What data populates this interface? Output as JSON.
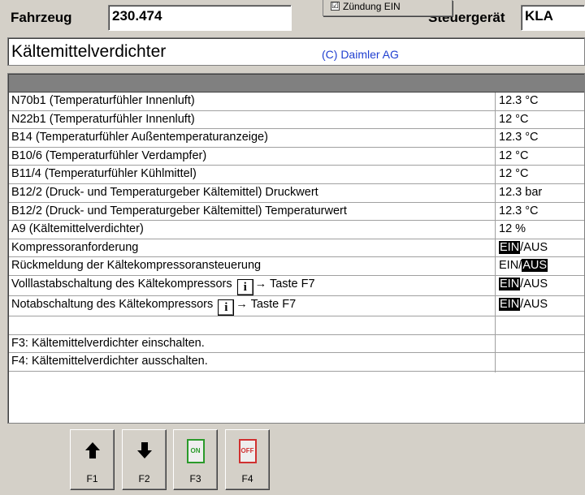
{
  "header": {
    "vehicle_label": "Fahrzeug",
    "vehicle_value": "230.474",
    "ecu_label": "Steuergerät",
    "ecu_value": "KLA",
    "popup_check": "☑",
    "popup_text": "Zündung EIN"
  },
  "title": {
    "text": "Kältemittelverdichter",
    "copyright": "(C) Daimler AG"
  },
  "rows": [
    {
      "name": "N70b1 (Temperaturfühler Innenluft)",
      "value": "12.3 °C"
    },
    {
      "name": "N22b1 (Temperaturfühler Innenluft)",
      "value": "12 °C"
    },
    {
      "name": "B14 (Temperaturfühler Außentemperaturanzeige)",
      "value": "12.3 °C"
    },
    {
      "name": "B10/6 (Temperaturfühler Verdampfer)",
      "value": "12 °C"
    },
    {
      "name": "B11/4 (Temperaturfühler Kühlmittel)",
      "value": "12 °C"
    },
    {
      "name": "B12/2 (Druck- und Temperaturgeber Kältemittel) Druckwert",
      "value": "12.3 bar"
    },
    {
      "name": "B12/2 (Druck- und Temperaturgeber Kältemittel) Temperaturwert",
      "value": "12.3 °C"
    },
    {
      "name": "A9 (Kältemittelverdichter)",
      "value": "12 %"
    },
    {
      "name": "Kompressoranforderung",
      "ein": "EIN",
      "sep": "/",
      "aus": "AUS",
      "active": "EIN"
    },
    {
      "name": "Rückmeldung der Kältekompressoransteuerung",
      "ein": "EIN",
      "sep": "/",
      "aus": "AUS",
      "active": "AUS"
    },
    {
      "name": "Volllastabschaltung des Kältekompressors",
      "info": "i",
      "arrow": "→",
      "hint": "Taste F7",
      "ein": "EIN",
      "sep": "/",
      "aus": "AUS",
      "active": "EIN"
    },
    {
      "name": "Notabschaltung des Kältekompressors",
      "info": "i",
      "arrow": "→",
      "hint": "Taste F7",
      "ein": "EIN",
      "sep": "/",
      "aus": "AUS",
      "active": "EIN"
    }
  ],
  "notes": [
    "F3: Kältemittelverdichter einschalten.",
    "F4: Kältemittelverdichter ausschalten."
  ],
  "buttons": [
    {
      "key": "F1",
      "icon": "arrow-up-icon"
    },
    {
      "key": "F2",
      "icon": "arrow-down-icon"
    },
    {
      "key": "F3",
      "icon": "switch-on-icon",
      "icon_text": "ON",
      "color": "#2a9a2a"
    },
    {
      "key": "F4",
      "icon": "switch-off-icon",
      "icon_text": "OFF",
      "color": "#d03030"
    }
  ]
}
